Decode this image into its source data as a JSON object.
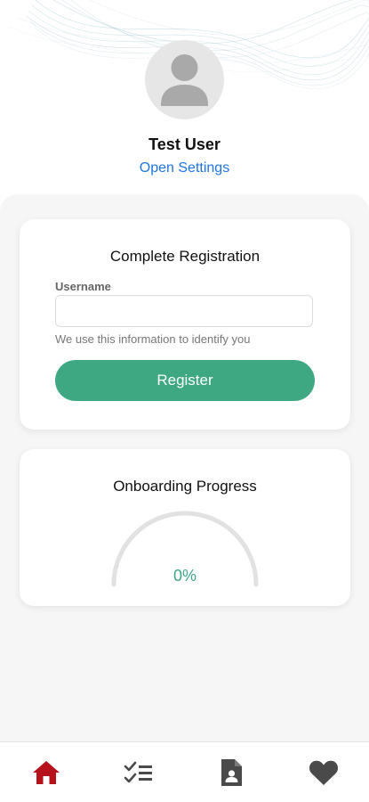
{
  "profile": {
    "name": "Test User",
    "settings_link": "Open Settings",
    "avatar_icon": "person-placeholder-icon"
  },
  "registration": {
    "title": "Complete Registration",
    "username_label": "Username",
    "username_value": "",
    "username_hint": "We use this information to identify you",
    "register_label": "Register"
  },
  "onboarding": {
    "title": "Onboarding Progress",
    "progress_text": "0%",
    "progress_fraction": 0
  },
  "bottom_nav": {
    "items": [
      {
        "icon": "home-icon",
        "active": true
      },
      {
        "icon": "checklist-icon",
        "active": false
      },
      {
        "icon": "document-person-icon",
        "active": false
      },
      {
        "icon": "heart-icon",
        "active": false
      }
    ]
  },
  "colors": {
    "accent_green": "#3ea883",
    "link_blue": "#1f74e0",
    "nav_active": "#b5121b",
    "nav_inactive": "#4a4a4a",
    "gauge_track": "#e2e2e2"
  }
}
